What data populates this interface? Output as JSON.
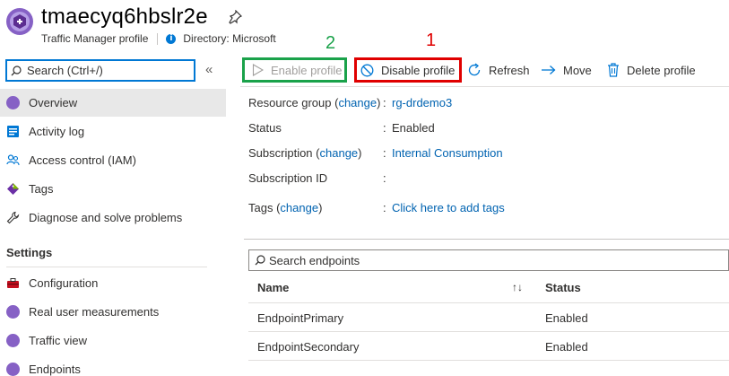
{
  "header": {
    "title": "tmaecyq6hbslr2e",
    "resource_type": "Traffic Manager profile",
    "directory": "Directory: Microsoft"
  },
  "sidebar": {
    "search_placeholder": "Search (Ctrl+/)",
    "collapse_glyph": "«",
    "items": [
      {
        "label": "Overview",
        "icon": "traffic-manager-icon",
        "active": true
      },
      {
        "label": "Activity log",
        "icon": "activity-log-icon"
      },
      {
        "label": "Access control (IAM)",
        "icon": "people-icon"
      },
      {
        "label": "Tags",
        "icon": "tag-icon"
      },
      {
        "label": "Diagnose and solve problems",
        "icon": "wrench-icon"
      }
    ],
    "settings_heading": "Settings",
    "settings_items": [
      {
        "label": "Configuration",
        "icon": "toolbox-icon"
      },
      {
        "label": "Real user measurements",
        "icon": "traffic-manager-icon"
      },
      {
        "label": "Traffic view",
        "icon": "traffic-manager-icon"
      },
      {
        "label": "Endpoints",
        "icon": "traffic-manager-icon"
      }
    ]
  },
  "toolbar": {
    "enable_label": "Enable profile",
    "disable_label": "Disable profile",
    "refresh_label": "Refresh",
    "move_label": "Move",
    "delete_label": "Delete profile",
    "annotation_enable": "2",
    "annotation_disable": "1"
  },
  "essentials": {
    "resource_group_label": "Resource group",
    "resource_group_change": "change",
    "resource_group_value": "rg-drdemo3",
    "status_label": "Status",
    "status_value": "Enabled",
    "subscription_label": "Subscription",
    "subscription_change": "change",
    "subscription_value": "Internal Consumption",
    "subscription_id_label": "Subscription ID",
    "subscription_id_value": "",
    "tags_label": "Tags",
    "tags_change": "change",
    "tags_value": "Click here to add tags"
  },
  "endpoints": {
    "search_placeholder": "Search endpoints",
    "columns": [
      "Name",
      "Status"
    ],
    "rows": [
      {
        "name": "EndpointPrimary",
        "status": "Enabled"
      },
      {
        "name": "EndpointSecondary",
        "status": "Enabled"
      }
    ]
  },
  "colors": {
    "accent": "#0078d4",
    "link": "#0063b1",
    "annotation_green": "#1aa24a",
    "annotation_red": "#e00000",
    "traffic_manager": "#8661c5"
  }
}
